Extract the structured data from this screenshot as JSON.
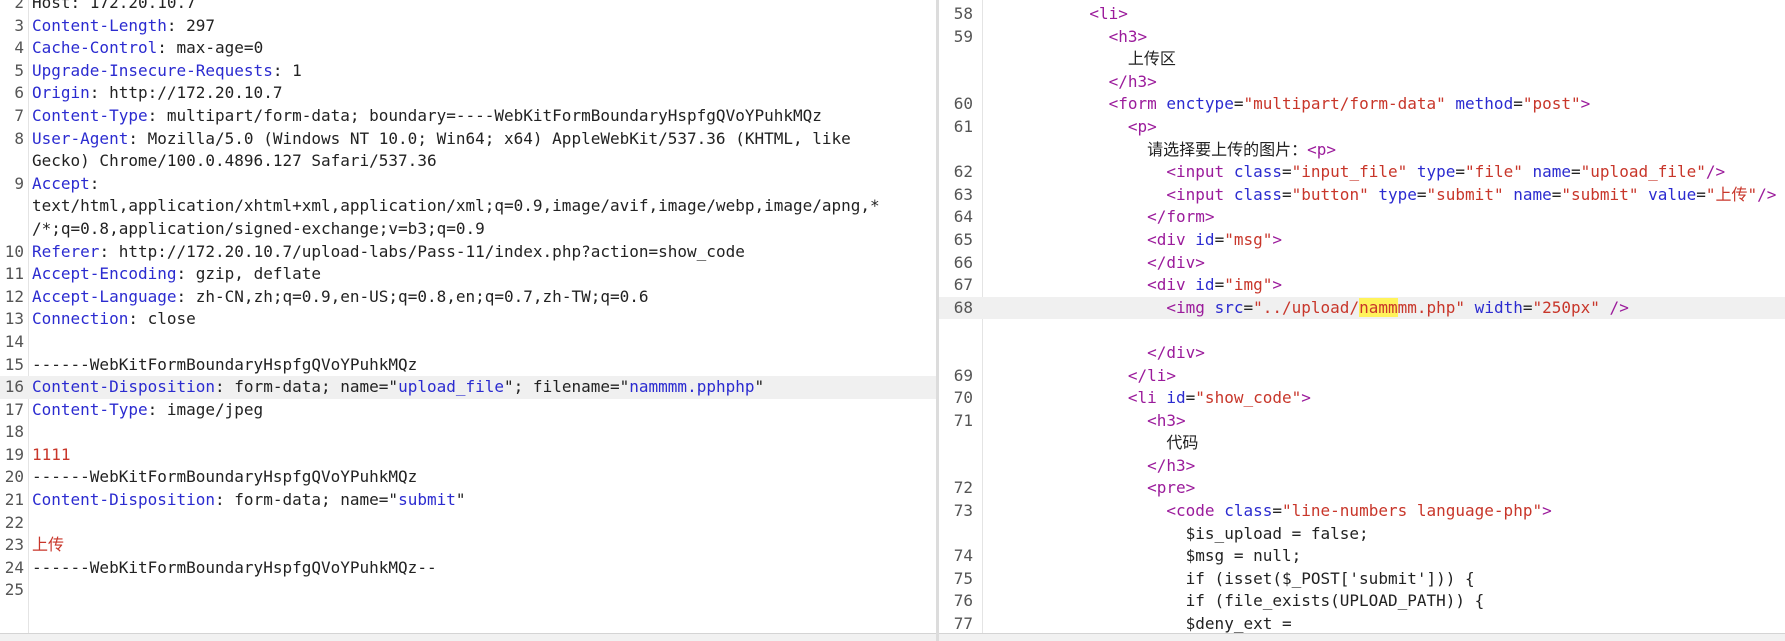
{
  "left_panel": {
    "lines": [
      {
        "n": "2",
        "parts": [
          {
            "t": "Host: 172.20.10.7",
            "c": "v"
          }
        ]
      },
      {
        "n": "3",
        "parts": [
          {
            "t": "Content-Length",
            "c": "k"
          },
          {
            "t": ": 297",
            "c": "v"
          }
        ]
      },
      {
        "n": "4",
        "parts": [
          {
            "t": "Cache-Control",
            "c": "k"
          },
          {
            "t": ": max-age=0",
            "c": "v"
          }
        ]
      },
      {
        "n": "5",
        "parts": [
          {
            "t": "Upgrade-Insecure-Requests",
            "c": "k"
          },
          {
            "t": ": 1",
            "c": "v"
          }
        ]
      },
      {
        "n": "6",
        "parts": [
          {
            "t": "Origin",
            "c": "k"
          },
          {
            "t": ": http://172.20.10.7",
            "c": "v"
          }
        ]
      },
      {
        "n": "7",
        "parts": [
          {
            "t": "Content-Type",
            "c": "k"
          },
          {
            "t": ": multipart/form-data; boundary=----WebKitFormBoundaryHspfgQVoYPuhkMQz",
            "c": "v"
          }
        ]
      },
      {
        "n": "8",
        "parts": [
          {
            "t": "User-Agent",
            "c": "k"
          },
          {
            "t": ": Mozilla/5.0 (Windows NT 10.0; Win64; x64) AppleWebKit/537.36 (KHTML, like",
            "c": "v"
          }
        ]
      },
      {
        "n": "",
        "parts": [
          {
            "t": "Gecko) Chrome/100.0.4896.127 Safari/537.36",
            "c": "v"
          }
        ]
      },
      {
        "n": "9",
        "parts": [
          {
            "t": "Accept",
            "c": "k"
          },
          {
            "t": ":",
            "c": "v"
          }
        ]
      },
      {
        "n": "",
        "parts": [
          {
            "t": "text/html,application/xhtml+xml,application/xml;q=0.9,image/avif,image/webp,image/apng,*",
            "c": "v"
          }
        ]
      },
      {
        "n": "",
        "parts": [
          {
            "t": "/*;q=0.8,application/signed-exchange;v=b3;q=0.9",
            "c": "v"
          }
        ]
      },
      {
        "n": "10",
        "parts": [
          {
            "t": "Referer",
            "c": "k"
          },
          {
            "t": ": http://172.20.10.7/upload-labs/Pass-11/index.php?action=show_code",
            "c": "v"
          }
        ]
      },
      {
        "n": "11",
        "parts": [
          {
            "t": "Accept-Encoding",
            "c": "k"
          },
          {
            "t": ": gzip, deflate",
            "c": "v"
          }
        ]
      },
      {
        "n": "12",
        "parts": [
          {
            "t": "Accept-Language",
            "c": "k"
          },
          {
            "t": ": zh-CN,zh;q=0.9,en-US;q=0.8,en;q=0.7,zh-TW;q=0.6",
            "c": "v"
          }
        ]
      },
      {
        "n": "13",
        "parts": [
          {
            "t": "Connection",
            "c": "k"
          },
          {
            "t": ": close",
            "c": "v"
          }
        ]
      },
      {
        "n": "14",
        "parts": []
      },
      {
        "n": "15",
        "parts": [
          {
            "t": "------WebKitFormBoundaryHspfgQVoYPuhkMQz",
            "c": "v"
          }
        ]
      },
      {
        "n": "16",
        "hl": true,
        "parts": [
          {
            "t": "Content-Disposition",
            "c": "k"
          },
          {
            "t": ": form-data; name=\"",
            "c": "v"
          },
          {
            "t": "upload_file",
            "c": "blu"
          },
          {
            "t": "\"; filename=\"",
            "c": "v"
          },
          {
            "t": "nammmm.pphphp",
            "c": "blu"
          },
          {
            "t": "\"",
            "c": "v"
          }
        ]
      },
      {
        "n": "17",
        "parts": [
          {
            "t": "Content-Type",
            "c": "k"
          },
          {
            "t": ": image/jpeg",
            "c": "v"
          }
        ]
      },
      {
        "n": "18",
        "parts": []
      },
      {
        "n": "19",
        "parts": [
          {
            "t": "1111",
            "c": "red"
          }
        ]
      },
      {
        "n": "20",
        "parts": [
          {
            "t": "------WebKitFormBoundaryHspfgQVoYPuhkMQz",
            "c": "v"
          }
        ]
      },
      {
        "n": "21",
        "parts": [
          {
            "t": "Content-Disposition",
            "c": "k"
          },
          {
            "t": ": form-data; name=\"",
            "c": "v"
          },
          {
            "t": "submit",
            "c": "blu"
          },
          {
            "t": "\"",
            "c": "v"
          }
        ]
      },
      {
        "n": "22",
        "parts": []
      },
      {
        "n": "23",
        "parts": [
          {
            "t": "上传",
            "c": "red"
          }
        ]
      },
      {
        "n": "24",
        "parts": [
          {
            "t": "------WebKitFormBoundaryHspfgQVoYPuhkMQz--",
            "c": "v"
          }
        ]
      },
      {
        "n": "25",
        "parts": []
      }
    ]
  },
  "right_panel": {
    "lines": [
      {
        "n": "58",
        "parts": [
          {
            "t": "          ",
            "c": "txt"
          },
          {
            "t": "<li>",
            "c": "tag"
          }
        ]
      },
      {
        "n": "59",
        "parts": [
          {
            "t": "            ",
            "c": "txt"
          },
          {
            "t": "<h3>",
            "c": "tag"
          }
        ]
      },
      {
        "n": "",
        "parts": [
          {
            "t": "              上传区",
            "c": "txt"
          }
        ]
      },
      {
        "n": "",
        "parts": [
          {
            "t": "            ",
            "c": "txt"
          },
          {
            "t": "</h3>",
            "c": "tag"
          }
        ]
      },
      {
        "n": "60",
        "parts": [
          {
            "t": "            ",
            "c": "txt"
          },
          {
            "t": "<form ",
            "c": "tag"
          },
          {
            "t": "enctype",
            "c": "attr"
          },
          {
            "t": "=",
            "c": "txt"
          },
          {
            "t": "\"multipart/form-data\"",
            "c": "str"
          },
          {
            "t": " method",
            "c": "attr"
          },
          {
            "t": "=",
            "c": "txt"
          },
          {
            "t": "\"post\"",
            "c": "str"
          },
          {
            "t": ">",
            "c": "tag"
          }
        ]
      },
      {
        "n": "61",
        "parts": [
          {
            "t": "              ",
            "c": "txt"
          },
          {
            "t": "<p>",
            "c": "tag"
          }
        ]
      },
      {
        "n": "",
        "parts": [
          {
            "t": "                请选择要上传的图片：",
            "c": "txt"
          },
          {
            "t": "<p>",
            "c": "tag"
          }
        ]
      },
      {
        "n": "62",
        "parts": [
          {
            "t": "                  ",
            "c": "txt"
          },
          {
            "t": "<input ",
            "c": "tag"
          },
          {
            "t": "class",
            "c": "attr"
          },
          {
            "t": "=",
            "c": "txt"
          },
          {
            "t": "\"input_file\"",
            "c": "str"
          },
          {
            "t": " type",
            "c": "attr"
          },
          {
            "t": "=",
            "c": "txt"
          },
          {
            "t": "\"file\"",
            "c": "str"
          },
          {
            "t": " name",
            "c": "attr"
          },
          {
            "t": "=",
            "c": "txt"
          },
          {
            "t": "\"upload_file\"",
            "c": "str"
          },
          {
            "t": "/>",
            "c": "tag"
          }
        ]
      },
      {
        "n": "63",
        "parts": [
          {
            "t": "                  ",
            "c": "txt"
          },
          {
            "t": "<input ",
            "c": "tag"
          },
          {
            "t": "class",
            "c": "attr"
          },
          {
            "t": "=",
            "c": "txt"
          },
          {
            "t": "\"button\"",
            "c": "str"
          },
          {
            "t": " type",
            "c": "attr"
          },
          {
            "t": "=",
            "c": "txt"
          },
          {
            "t": "\"submit\"",
            "c": "str"
          },
          {
            "t": " name",
            "c": "attr"
          },
          {
            "t": "=",
            "c": "txt"
          },
          {
            "t": "\"submit\"",
            "c": "str"
          },
          {
            "t": " value",
            "c": "attr"
          },
          {
            "t": "=",
            "c": "txt"
          },
          {
            "t": "\"上传\"",
            "c": "str"
          },
          {
            "t": "/>",
            "c": "tag"
          }
        ]
      },
      {
        "n": "64",
        "parts": [
          {
            "t": "                ",
            "c": "txt"
          },
          {
            "t": "</form>",
            "c": "tag"
          }
        ]
      },
      {
        "n": "65",
        "parts": [
          {
            "t": "                ",
            "c": "txt"
          },
          {
            "t": "<div ",
            "c": "tag"
          },
          {
            "t": "id",
            "c": "attr"
          },
          {
            "t": "=",
            "c": "txt"
          },
          {
            "t": "\"msg\"",
            "c": "str"
          },
          {
            "t": ">",
            "c": "tag"
          }
        ]
      },
      {
        "n": "66",
        "parts": [
          {
            "t": "                ",
            "c": "txt"
          },
          {
            "t": "</div>",
            "c": "tag"
          }
        ]
      },
      {
        "n": "67",
        "parts": [
          {
            "t": "                ",
            "c": "txt"
          },
          {
            "t": "<div ",
            "c": "tag"
          },
          {
            "t": "id",
            "c": "attr"
          },
          {
            "t": "=",
            "c": "txt"
          },
          {
            "t": "\"img\"",
            "c": "str"
          },
          {
            "t": ">",
            "c": "tag"
          }
        ]
      },
      {
        "n": "68",
        "hl": true,
        "parts": [
          {
            "t": "                  ",
            "c": "txt"
          },
          {
            "t": "<img ",
            "c": "tag"
          },
          {
            "t": "src",
            "c": "attr"
          },
          {
            "t": "=",
            "c": "txt"
          },
          {
            "t": "\"../upload/",
            "c": "str"
          },
          {
            "t": "namm",
            "c": "str mark"
          },
          {
            "t": "mm.php\"",
            "c": "str"
          },
          {
            "t": " width",
            "c": "attr"
          },
          {
            "t": "=",
            "c": "txt"
          },
          {
            "t": "\"250px\"",
            "c": "str"
          },
          {
            "t": " />",
            "c": "tag"
          }
        ]
      },
      {
        "n": "",
        "parts": []
      },
      {
        "n": "",
        "parts": [
          {
            "t": "                ",
            "c": "txt"
          },
          {
            "t": "</div>",
            "c": "tag"
          }
        ]
      },
      {
        "n": "69",
        "parts": [
          {
            "t": "              ",
            "c": "txt"
          },
          {
            "t": "</li>",
            "c": "tag"
          }
        ]
      },
      {
        "n": "70",
        "parts": [
          {
            "t": "              ",
            "c": "txt"
          },
          {
            "t": "<li ",
            "c": "tag"
          },
          {
            "t": "id",
            "c": "attr"
          },
          {
            "t": "=",
            "c": "txt"
          },
          {
            "t": "\"show_code\"",
            "c": "str"
          },
          {
            "t": ">",
            "c": "tag"
          }
        ]
      },
      {
        "n": "71",
        "parts": [
          {
            "t": "                ",
            "c": "txt"
          },
          {
            "t": "<h3>",
            "c": "tag"
          }
        ]
      },
      {
        "n": "",
        "parts": [
          {
            "t": "                  代码",
            "c": "txt"
          }
        ]
      },
      {
        "n": "",
        "parts": [
          {
            "t": "                ",
            "c": "txt"
          },
          {
            "t": "</h3>",
            "c": "tag"
          }
        ]
      },
      {
        "n": "72",
        "parts": [
          {
            "t": "                ",
            "c": "txt"
          },
          {
            "t": "<pre>",
            "c": "tag"
          }
        ]
      },
      {
        "n": "73",
        "parts": [
          {
            "t": "                  ",
            "c": "txt"
          },
          {
            "t": "<code ",
            "c": "tag"
          },
          {
            "t": "class",
            "c": "attr"
          },
          {
            "t": "=",
            "c": "txt"
          },
          {
            "t": "\"line-numbers language-php\"",
            "c": "str"
          },
          {
            "t": ">",
            "c": "tag"
          }
        ]
      },
      {
        "n": "",
        "parts": [
          {
            "t": "                    $is_upload = false;",
            "c": "txt"
          }
        ]
      },
      {
        "n": "74",
        "parts": [
          {
            "t": "                    $msg = null;",
            "c": "txt"
          }
        ]
      },
      {
        "n": "75",
        "parts": [
          {
            "t": "                    if (isset($_POST['submit'])) {",
            "c": "txt"
          }
        ]
      },
      {
        "n": "76",
        "parts": [
          {
            "t": "                    if (file_exists(UPLOAD_PATH)) {",
            "c": "txt"
          }
        ]
      },
      {
        "n": "77",
        "parts": [
          {
            "t": "                    $deny_ext =",
            "c": "txt"
          }
        ]
      }
    ]
  }
}
